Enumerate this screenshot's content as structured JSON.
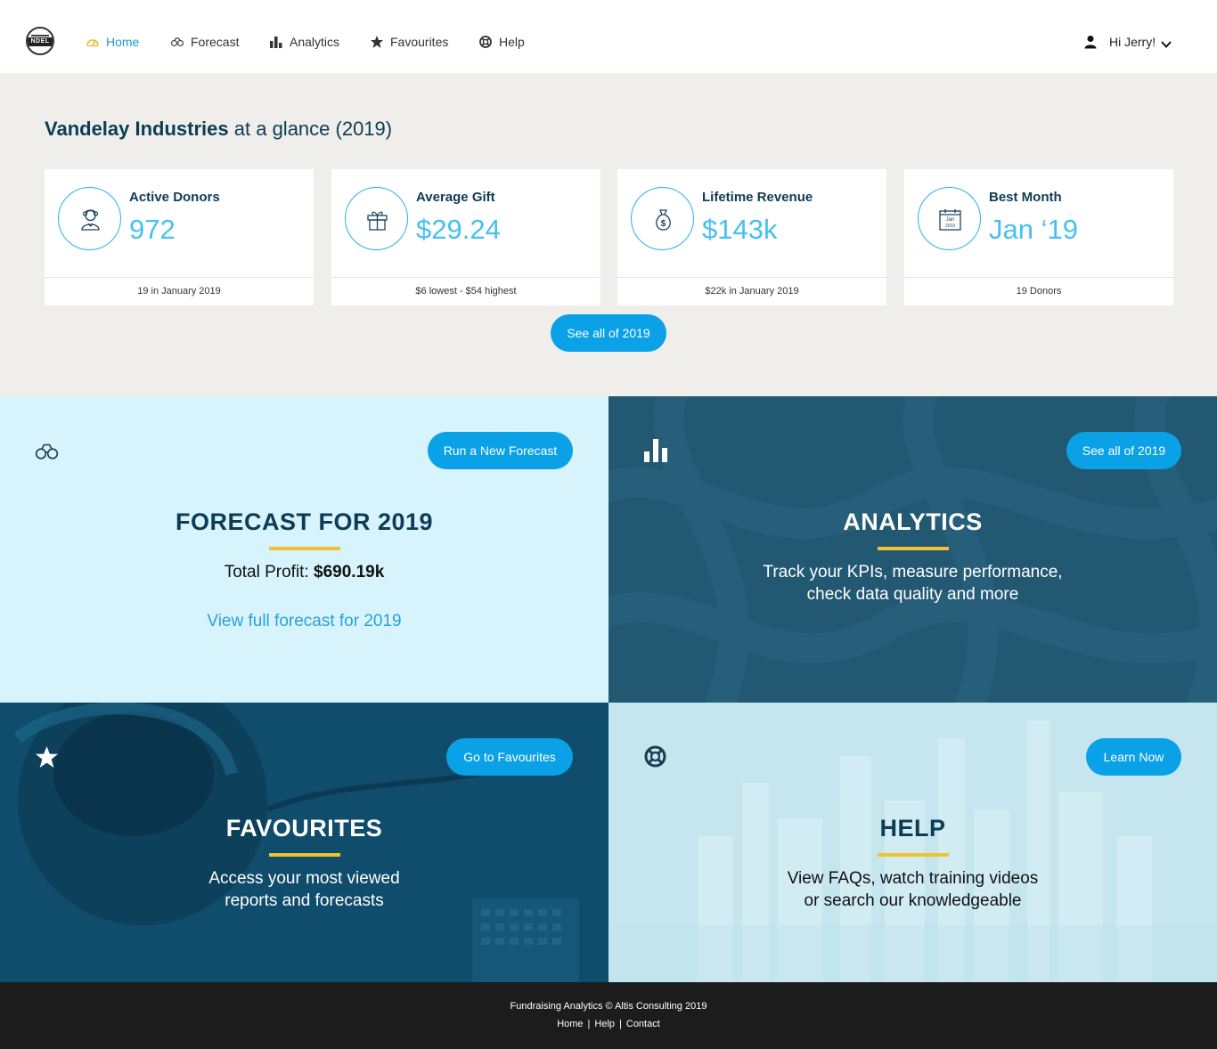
{
  "nav": {
    "logo_text": "NDEL",
    "items": [
      {
        "label": "Home",
        "icon": "gauge-icon",
        "active": true
      },
      {
        "label": "Forecast",
        "icon": "binoculars-icon"
      },
      {
        "label": "Analytics",
        "icon": "bar-chart-icon"
      },
      {
        "label": "Favourites",
        "icon": "star-icon"
      },
      {
        "label": "Help",
        "icon": "lifebuoy-icon"
      }
    ],
    "user_greeting": "Hi Jerry!"
  },
  "glance": {
    "title_company": "Vandelay Industries",
    "title_rest": "at a glance (2019)",
    "cards": [
      {
        "label": "Active Donors",
        "value": "972",
        "footer": "19 in January 2019",
        "icon": "donor-icon"
      },
      {
        "label": "Average Gift",
        "value": "$29.24",
        "footer": "$6 lowest - $54 highest",
        "icon": "gift-icon"
      },
      {
        "label": "Lifetime Revenue",
        "value": "$143k",
        "footer": "$22k in January 2019",
        "icon": "money-bag-icon"
      },
      {
        "label": "Best Month",
        "value": "Jan ‘19",
        "footer": "19 Donors",
        "icon": "calendar-icon",
        "calendar_month": "Jan",
        "calendar_year": "2019"
      }
    ],
    "see_all_label": "See all of 2019"
  },
  "forecast": {
    "button": "Run a New Forecast",
    "title": "FORECAST FOR 2019",
    "profit_label": "Total Profit:",
    "profit_value": "$690.19k",
    "link": "View full forecast for 2019"
  },
  "analytics": {
    "button": "See all of 2019",
    "title": "ANALYTICS",
    "desc_line1": "Track your KPIs, measure performance,",
    "desc_line2": "check data quality and more"
  },
  "favourites": {
    "button": "Go to Favourites",
    "title": "FAVOURITES",
    "desc_line1": "Access your most viewed",
    "desc_line2": "reports and forecasts"
  },
  "help": {
    "button": "Learn Now",
    "title": "HELP",
    "desc_line1": "View FAQs, watch training videos",
    "desc_line2": "or search our knowledgeable"
  },
  "footer": {
    "copyright": "Fundraising Analytics © Altis Consulting 2019",
    "links": [
      "Home",
      "Help",
      "Contact"
    ]
  },
  "colors": {
    "accent_blue": "#0aa1e6",
    "navy": "#0d3c55",
    "value_blue": "#45c1ef",
    "underline_yellow": "#f2c12e"
  }
}
